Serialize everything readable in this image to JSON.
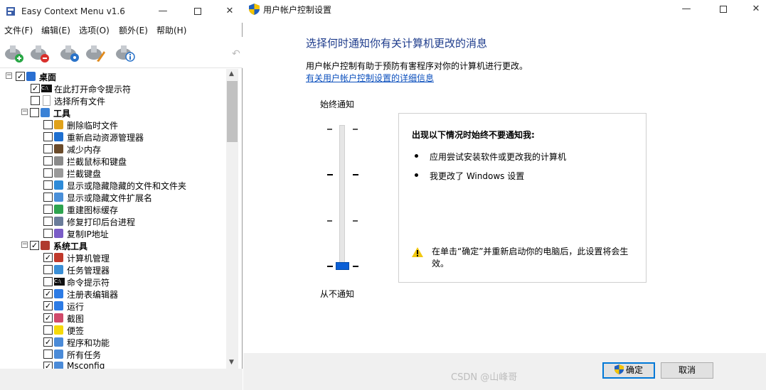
{
  "left_window": {
    "title": "Easy Context Menu v1.6",
    "menu": [
      "文件(F)",
      "编辑(E)",
      "选项(O)",
      "额外(E)",
      "帮助(H)"
    ],
    "tree": [
      {
        "label": "桌面",
        "bold": true,
        "checked": true,
        "level": 0,
        "icon": "desktop-icon"
      },
      {
        "label": "在此打开命令提示符",
        "checked": true,
        "level": 1,
        "icon": "cmd-icon"
      },
      {
        "label": "选择所有文件",
        "checked": false,
        "level": 1,
        "icon": "blank-icon"
      },
      {
        "label": "工具",
        "bold": true,
        "checked": false,
        "level": 1,
        "icon": "tools-icon",
        "group": true
      },
      {
        "label": "删除临时文件",
        "checked": false,
        "level": 2,
        "icon": "broom-icon"
      },
      {
        "label": "重新启动资源管理器",
        "checked": false,
        "level": 2,
        "icon": "refresh-icon"
      },
      {
        "label": "减少内存",
        "checked": false,
        "level": 2,
        "icon": "memory-icon"
      },
      {
        "label": "拦截鼠标和键盘",
        "checked": false,
        "level": 2,
        "icon": "keyboard-mouse-icon"
      },
      {
        "label": "拦截键盘",
        "checked": false,
        "level": 2,
        "icon": "keyboard-icon"
      },
      {
        "label": "显示或隐藏隐藏的文件和文件夹",
        "checked": false,
        "level": 2,
        "icon": "hidden-files-icon"
      },
      {
        "label": "显示或隐藏文件扩展名",
        "checked": false,
        "level": 2,
        "icon": "extension-icon"
      },
      {
        "label": "重建图标缓存",
        "checked": false,
        "level": 2,
        "icon": "rebuild-icon"
      },
      {
        "label": "修复打印后台进程",
        "checked": false,
        "level": 2,
        "icon": "printer-icon"
      },
      {
        "label": "复制IP地址",
        "checked": false,
        "level": 2,
        "icon": "ip-icon"
      },
      {
        "label": "系统工具",
        "bold": true,
        "checked": true,
        "level": 1,
        "icon": "system-tools-icon",
        "group": true
      },
      {
        "label": "计算机管理",
        "checked": true,
        "level": 2,
        "icon": "computer-manage-icon"
      },
      {
        "label": "任务管理器",
        "checked": false,
        "level": 2,
        "icon": "task-manager-icon"
      },
      {
        "label": "命令提示符",
        "checked": false,
        "level": 2,
        "icon": "cmd-icon"
      },
      {
        "label": "注册表编辑器",
        "checked": true,
        "level": 2,
        "icon": "regedit-icon"
      },
      {
        "label": "运行",
        "checked": true,
        "level": 2,
        "icon": "run-icon"
      },
      {
        "label": "截图",
        "checked": true,
        "level": 2,
        "icon": "snip-icon"
      },
      {
        "label": "便签",
        "checked": false,
        "level": 2,
        "icon": "sticky-note-icon"
      },
      {
        "label": "程序和功能",
        "checked": true,
        "level": 2,
        "icon": "programs-icon"
      },
      {
        "label": "所有任务",
        "checked": false,
        "level": 2,
        "icon": "all-tasks-icon"
      },
      {
        "label": "Msconfig",
        "checked": true,
        "level": 2,
        "icon": "msconfig-icon"
      }
    ]
  },
  "uac_dialog": {
    "title": "用户帐户控制设置",
    "heading": "选择何时通知你有关计算机更改的消息",
    "description": "用户帐户控制有助于预防有害程序对你的计算机进行更改。",
    "link": "有关用户帐户控制设置的详细信息",
    "slider_top_label": "始终通知",
    "slider_bottom_label": "从不通知",
    "slider_level": 0,
    "slider_levels": 4,
    "info_heading": "出现以下情况时始终不要通知我:",
    "bullets": [
      "应用尝试安装软件或更改我的计算机",
      "我更改了 Windows 设置"
    ],
    "warning": "在单击“确定”并重新启动你的电脑后，此设置将会生效。",
    "ok_label": "确定",
    "cancel_label": "取消"
  },
  "watermark": "CSDN @山峰哥",
  "colors": {
    "heading": "#1e3c8c",
    "link": "#0b4fbd",
    "slider_thumb": "#0a5fd6",
    "ok_border": "#0078d7"
  }
}
